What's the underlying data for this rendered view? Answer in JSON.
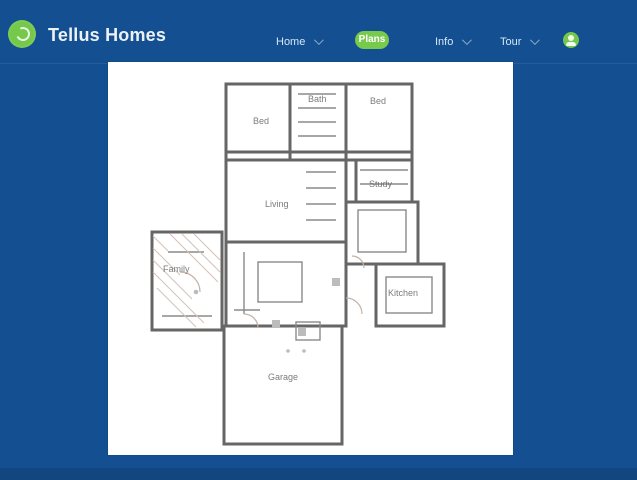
{
  "app": {
    "brand": "Tellus Homes",
    "colors": {
      "background": "#134f91",
      "accent": "#74c84a",
      "panel": "#ffffff",
      "wall": "#5c5c5c"
    }
  },
  "nav": {
    "items": [
      {
        "label": "Home"
      },
      {
        "label": "Plans"
      },
      {
        "label": "Info"
      },
      {
        "label": "Tour"
      }
    ],
    "avatar_icon": "user-icon"
  },
  "floorplan": {
    "rooms": [
      {
        "id": "bed-1",
        "label": "Bed"
      },
      {
        "id": "bath",
        "label": "Bath"
      },
      {
        "id": "bed-2",
        "label": "Bed"
      },
      {
        "id": "living",
        "label": "Living"
      },
      {
        "id": "study",
        "label": "Study"
      },
      {
        "id": "family",
        "label": "Family"
      },
      {
        "id": "kitchen",
        "label": "Kitchen"
      },
      {
        "id": "garage",
        "label": "Garage"
      }
    ]
  }
}
